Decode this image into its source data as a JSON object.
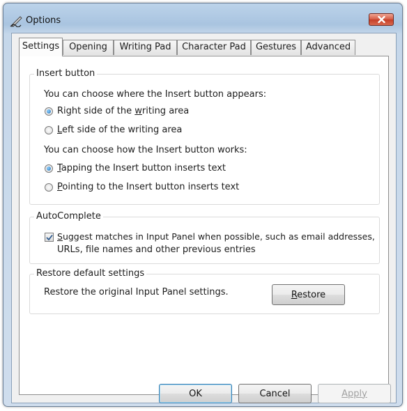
{
  "window": {
    "title": "Options"
  },
  "tabs": [
    {
      "label": "Settings"
    },
    {
      "label": "Opening"
    },
    {
      "label": "Writing Pad"
    },
    {
      "label": "Character Pad"
    },
    {
      "label": "Gestures"
    },
    {
      "label": "Advanced"
    }
  ],
  "insert_button": {
    "title": "Insert button",
    "where_prompt": "You can choose where the Insert button appears:",
    "where_options": [
      {
        "pre": "Right side of the ",
        "key": "w",
        "post": "riting area",
        "selected": true
      },
      {
        "pre": "",
        "key": "L",
        "post": "eft side of the writing area",
        "selected": false
      }
    ],
    "how_prompt": "You can choose how the Insert button works:",
    "how_options": [
      {
        "pre": "",
        "key": "T",
        "post": "apping the Insert button inserts text",
        "selected": true
      },
      {
        "pre": "",
        "key": "P",
        "post": "ointing to the Insert button inserts text",
        "selected": false
      }
    ]
  },
  "autocomplete": {
    "title": "AutoComplete",
    "checked": true,
    "label_key": "S",
    "label_line1_rest": "uggest matches in Input Panel when possible, such as email addresses,",
    "label_line2": "URLs, file names and other previous entries"
  },
  "restore": {
    "title": "Restore default settings",
    "description": "Restore the original Input Panel settings.",
    "button_key": "R",
    "button_rest": "estore"
  },
  "footer": {
    "ok_label": "OK",
    "cancel_label": "Cancel",
    "apply_label": "Apply"
  }
}
